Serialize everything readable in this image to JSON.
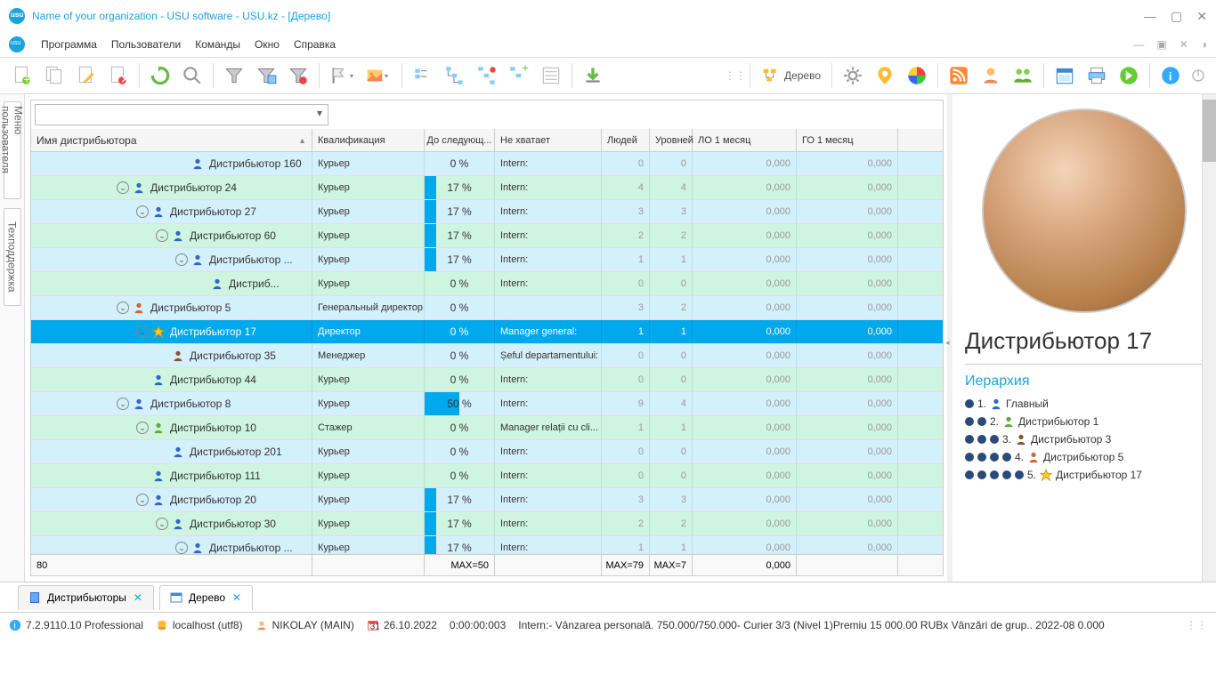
{
  "window": {
    "title": "Name of your organization - USU software - USU.kz - [Дерево]"
  },
  "menu": [
    "Программа",
    "Пользователи",
    "Команды",
    "Окно",
    "Справка"
  ],
  "toolbar": {
    "tree_label": "Дерево"
  },
  "sidetabs": [
    "Меню пользователя",
    "Техподдержка"
  ],
  "columns": {
    "name": "Имя дистрибьютора",
    "qual": "Квалификация",
    "next": "До следующ...",
    "miss": "Не хватает",
    "ppl": "Людей",
    "lvl": "Уровней",
    "lo": "ЛО 1 месяц",
    "go": "ГО 1 месяц"
  },
  "rows": [
    {
      "indent": 7,
      "exp": "",
      "ico": "person",
      "name": "Дистрибьютор 160",
      "qual": "Курьер",
      "pct": 0,
      "miss": "Intern:",
      "ppl": 0,
      "lvl": 0,
      "lo": "0,000",
      "go": "0,000",
      "c": "odd"
    },
    {
      "indent": 4,
      "exp": "v",
      "ico": "person",
      "name": "Дистрибьютор 24",
      "qual": "Курьер",
      "pct": 17,
      "miss": "Intern:",
      "ppl": 4,
      "lvl": 4,
      "lo": "0,000",
      "go": "0,000",
      "c": "even"
    },
    {
      "indent": 5,
      "exp": "v",
      "ico": "person",
      "name": "Дистрибьютор 27",
      "qual": "Курьер",
      "pct": 17,
      "miss": "Intern:",
      "ppl": 3,
      "lvl": 3,
      "lo": "0,000",
      "go": "0,000",
      "c": "odd"
    },
    {
      "indent": 6,
      "exp": "v",
      "ico": "person",
      "name": "Дистрибьютор 60",
      "qual": "Курьер",
      "pct": 17,
      "miss": "Intern:",
      "ppl": 2,
      "lvl": 2,
      "lo": "0,000",
      "go": "0,000",
      "c": "even"
    },
    {
      "indent": 7,
      "exp": "v",
      "ico": "person",
      "name": "Дистрибьютор ...",
      "qual": "Курьер",
      "pct": 17,
      "miss": "Intern:",
      "ppl": 1,
      "lvl": 1,
      "lo": "0,000",
      "go": "0,000",
      "c": "odd"
    },
    {
      "indent": 8,
      "exp": "",
      "ico": "person",
      "name": "Дистриб...",
      "qual": "Курьер",
      "pct": 0,
      "miss": "Intern:",
      "ppl": 0,
      "lvl": 0,
      "lo": "0,000",
      "go": "0,000",
      "c": "even"
    },
    {
      "indent": 4,
      "exp": "v",
      "ico": "boss",
      "name": "Дистрибьютор 5",
      "qual": "Генеральный директор",
      "pct": 0,
      "miss": "",
      "ppl": 3,
      "lvl": 2,
      "lo": "0,000",
      "go": "0,000",
      "c": "odd"
    },
    {
      "indent": 5,
      "exp": "v",
      "ico": "star",
      "name": "Дистрибьютор 17",
      "qual": "Директор",
      "pct": 0,
      "miss": "Manager general:",
      "ppl": 1,
      "lvl": 1,
      "lo": "0,000",
      "go": "0,000",
      "c": "selected"
    },
    {
      "indent": 6,
      "exp": "",
      "ico": "mgr",
      "name": "Дистрибьютор 35",
      "qual": "Менеджер",
      "pct": 0,
      "miss": "Șeful departamentului:",
      "ppl": 0,
      "lvl": 0,
      "lo": "0,000",
      "go": "0,000",
      "c": "odd"
    },
    {
      "indent": 5,
      "exp": "",
      "ico": "person",
      "name": "Дистрибьютор 44",
      "qual": "Курьер",
      "pct": 0,
      "miss": "Intern:",
      "ppl": 0,
      "lvl": 0,
      "lo": "0,000",
      "go": "0,000",
      "c": "even"
    },
    {
      "indent": 4,
      "exp": "v",
      "ico": "person",
      "name": "Дистрибьютор 8",
      "qual": "Курьер",
      "pct": 50,
      "miss": "Intern:",
      "ppl": 9,
      "lvl": 4,
      "lo": "0,000",
      "go": "0,000",
      "c": "odd"
    },
    {
      "indent": 5,
      "exp": "v",
      "ico": "intern",
      "name": "Дистрибьютор 10",
      "qual": "Стажер",
      "pct": 0,
      "miss": "Manager relații cu cli...",
      "ppl": 1,
      "lvl": 1,
      "lo": "0,000",
      "go": "0,000",
      "c": "even"
    },
    {
      "indent": 6,
      "exp": "",
      "ico": "person",
      "name": "Дистрибьютор 201",
      "qual": "Курьер",
      "pct": 0,
      "miss": "Intern:",
      "ppl": 0,
      "lvl": 0,
      "lo": "0,000",
      "go": "0,000",
      "c": "odd"
    },
    {
      "indent": 5,
      "exp": "",
      "ico": "person",
      "name": "Дистрибьютор 111",
      "qual": "Курьер",
      "pct": 0,
      "miss": "Intern:",
      "ppl": 0,
      "lvl": 0,
      "lo": "0,000",
      "go": "0,000",
      "c": "even"
    },
    {
      "indent": 5,
      "exp": "v",
      "ico": "person",
      "name": "Дистрибьютор 20",
      "qual": "Курьер",
      "pct": 17,
      "miss": "Intern:",
      "ppl": 3,
      "lvl": 3,
      "lo": "0,000",
      "go": "0,000",
      "c": "odd"
    },
    {
      "indent": 6,
      "exp": "v",
      "ico": "person",
      "name": "Дистрибьютор 30",
      "qual": "Курьер",
      "pct": 17,
      "miss": "Intern:",
      "ppl": 2,
      "lvl": 2,
      "lo": "0,000",
      "go": "0,000",
      "c": "even"
    },
    {
      "indent": 7,
      "exp": "v",
      "ico": "person",
      "name": "Дистрибьютор ...",
      "qual": "Курьер",
      "pct": 17,
      "miss": "Intern:",
      "ppl": 1,
      "lvl": 1,
      "lo": "0,000",
      "go": "0,000",
      "c": "odd"
    }
  ],
  "footer": {
    "count": "80",
    "next": "MAX=50",
    "ppl": "MAX=79",
    "lvl": "MAX=7",
    "lo": "0,000"
  },
  "detail": {
    "name": "Дистрибьютор 17",
    "hier_title": "Иерархия",
    "hier": [
      {
        "dots": 1,
        "num": "1.",
        "ico": "person",
        "label": "Главный"
      },
      {
        "dots": 2,
        "num": "2.",
        "ico": "intern",
        "label": "Дистрибьютор 1"
      },
      {
        "dots": 3,
        "num": "3.",
        "ico": "mgr",
        "label": "Дистрибьютор 3"
      },
      {
        "dots": 4,
        "num": "4.",
        "ico": "boss",
        "label": "Дистрибьютор 5"
      },
      {
        "dots": 5,
        "num": "5.",
        "ico": "star",
        "label": "Дистрибьютор 17"
      }
    ]
  },
  "tabs": [
    {
      "label": "Дистрибьюторы",
      "ico": "book",
      "active": false
    },
    {
      "label": "Дерево",
      "ico": "window",
      "active": true
    }
  ],
  "status": {
    "version": "7.2.9110.10 Professional",
    "host": "localhost (utf8)",
    "user": "NIKOLAY (MAIN)",
    "date": "26.10.2022",
    "timer": "0:00:00:003",
    "marquee": "Intern:- Vânzarea personală. 750.000/750.000- Curier 3/3 (Nivel 1)Premiu 15 000.00 RUBx   Vânzări de grup.. 2022-08 0.000"
  }
}
